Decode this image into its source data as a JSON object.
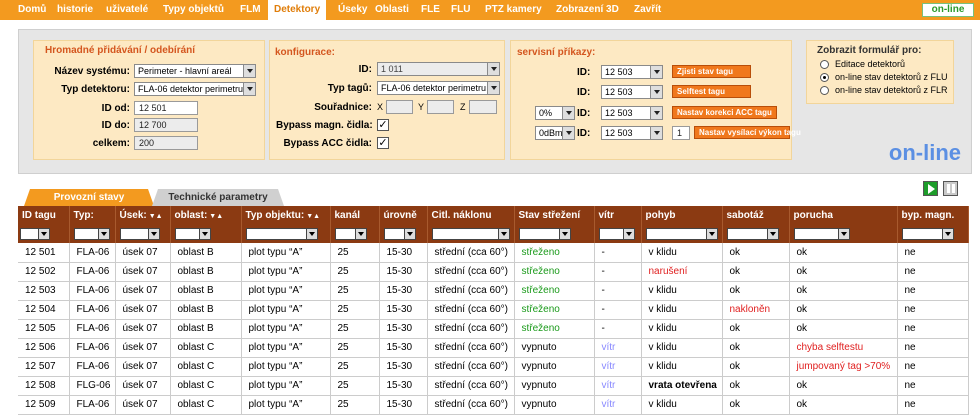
{
  "menu": {
    "items": [
      "Domů",
      "historie",
      "uživatelé",
      "Typy objektů",
      "FLM",
      "Detektory",
      "Úseky",
      "Oblasti",
      "FLE",
      "FLU",
      "PTZ kamery",
      "Zobrazení 3D",
      "Zavřít"
    ],
    "active": "Detektory",
    "status": "on-line"
  },
  "mass": {
    "title": "Hromadné přidávání / odebírání",
    "system_label": "Název systému:",
    "system_value": "Perimeter - hlavní areál",
    "type_label": "Typ detektoru:",
    "type_value": "FLA-06 detektor perimetru",
    "from_label": "ID od:",
    "from_value": "12 501",
    "to_label": "ID do:",
    "to_value": "12 700",
    "total_label": "celkem:",
    "total_value": "200"
  },
  "config": {
    "title": "konfigurace:",
    "id_label": "ID:",
    "id_value": "1 011",
    "tag_label": "Typ tagů:",
    "tag_value": "FLA-06 detektor perimetru",
    "coord_label": "Souřadnice:",
    "x": "X",
    "y": "Y",
    "z": "Z",
    "bypass_mag_label": "Bypass magn. čidla:",
    "bypass_acc_label": "Bypass ACC čidla:",
    "check": "✓"
  },
  "service": {
    "title": "servisní příkazy:",
    "id_label": "ID:",
    "rows": [
      {
        "id": "12 503",
        "button": "Zjisti stav tagu"
      },
      {
        "id": "12 503",
        "button": "Selftest tagu"
      },
      {
        "pre": "0%",
        "id": "12 503",
        "button": "Nastav korekci ACC tagu"
      },
      {
        "pre": "0dBm",
        "id": "12 503",
        "num": "1",
        "button": "Nastav vysílací výkon tagu"
      }
    ]
  },
  "form": {
    "title": "Zobrazit formulář pro:",
    "options": [
      "Editace detektorů",
      "on-line stav detektorů z FLU",
      "on-line stav detektorů z FLR"
    ],
    "selected": 1
  },
  "online_big": "on-line",
  "tabs": [
    "Provozní stavy",
    "Technické parametry"
  ],
  "table": {
    "headers": [
      "ID tagu",
      "Typ:",
      "Úsek:",
      "oblast:",
      "Typ objektu:",
      "kanál",
      "úrovně",
      "Citl. náklonu",
      "Stav střežení",
      "vítr",
      "pohyb",
      "sabotáž",
      "porucha",
      "byp. magn."
    ],
    "sort_mark": "▼▲",
    "rows": [
      [
        "12 501",
        "FLA-06",
        "úsek 07",
        "oblast B",
        "plot typu “A”",
        "25",
        "15-30",
        "střední (cca 60°)",
        "střeženo",
        "-",
        "v klidu",
        "ok",
        "ok",
        "ne"
      ],
      [
        "12 502",
        "FLA-06",
        "úsek 07",
        "oblast B",
        "plot typu “A”",
        "25",
        "15-30",
        "střední (cca 60°)",
        "střeženo",
        "-",
        "narušení",
        "ok",
        "ok",
        "ne"
      ],
      [
        "12 503",
        "FLA-06",
        "úsek 07",
        "oblast B",
        "plot typu “A”",
        "25",
        "15-30",
        "střední (cca 60°)",
        "střeženo",
        "-",
        "v klidu",
        "ok",
        "ok",
        "ne"
      ],
      [
        "12 504",
        "FLA-06",
        "úsek 07",
        "oblast B",
        "plot typu “A”",
        "25",
        "15-30",
        "střední (cca 60°)",
        "střeženo",
        "-",
        "v klidu",
        "nakloněn",
        "ok",
        "ne"
      ],
      [
        "12 505",
        "FLA-06",
        "úsek 07",
        "oblast B",
        "plot typu “A”",
        "25",
        "15-30",
        "střední (cca 60°)",
        "střeženo",
        "-",
        "v klidu",
        "ok",
        "ok",
        "ne"
      ],
      [
        "12 506",
        "FLA-06",
        "úsek 07",
        "oblast C",
        "plot typu “A”",
        "25",
        "15-30",
        "střední (cca 60°)",
        "vypnuto",
        "vítr",
        "v klidu",
        "ok",
        "chyba selftestu",
        "ne"
      ],
      [
        "12 507",
        "FLA-06",
        "úsek 07",
        "oblast C",
        "plot typu “A”",
        "25",
        "15-30",
        "střední (cca 60°)",
        "vypnuto",
        "vítr",
        "v klidu",
        "ok",
        "jumpovaný tag >70%",
        "ne"
      ],
      [
        "12 508",
        "FLG-06",
        "úsek 07",
        "oblast C",
        "plot typu “A”",
        "25",
        "15-30",
        "střední (cca 60°)",
        "vypnuto",
        "vítr",
        "vrata otevřena",
        "ok",
        "ok",
        "ne"
      ],
      [
        "12 509",
        "FLA-06",
        "úsek 07",
        "oblast C",
        "plot typu “A”",
        "25",
        "15-30",
        "střední (cca 60°)",
        "vypnuto",
        "vítr",
        "v klidu",
        "ok",
        "ok",
        "ne"
      ]
    ]
  },
  "colors": {
    "accent": "#f39a1f",
    "header": "#8b3a12",
    "ok_green": "#1a9a1a",
    "alert_red": "#e02020",
    "wind_blue": "#8888ff",
    "online_blue": "#5b8fe3"
  }
}
